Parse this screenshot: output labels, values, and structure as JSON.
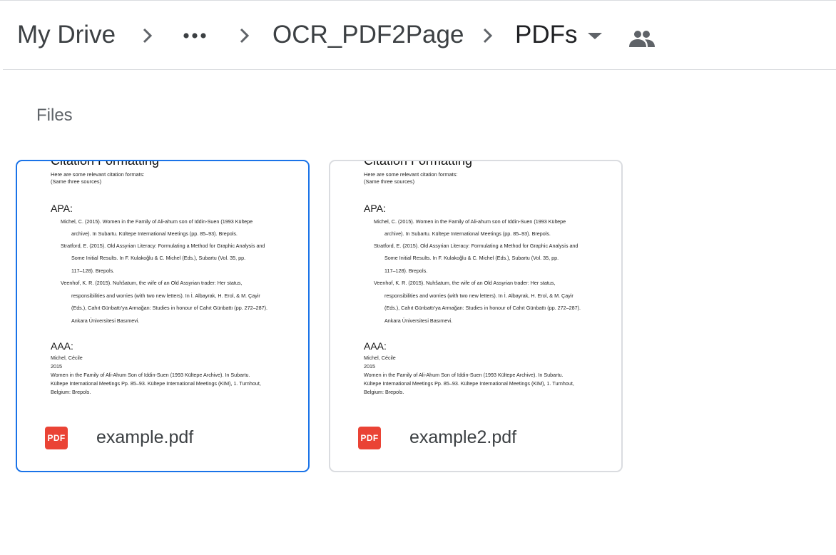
{
  "breadcrumb": {
    "root": "My Drive",
    "ellipsis": "•••",
    "parent": "OCR_PDF2Page",
    "current": "PDFs"
  },
  "section": {
    "title": "Files"
  },
  "colors": {
    "accent": "#1a73e8",
    "pdf_badge": "#ea4335",
    "border": "#dadce0"
  },
  "files": [
    {
      "name": "example.pdf",
      "badge": "PDF",
      "selected": true,
      "preview": {
        "heading": "Citation Formatting",
        "intro": "Here are some relevant citation formats:",
        "note": "(Same three sources)",
        "apa_title": "APA:",
        "apa_lines": [
          "Michel, C. (2015). Women in the Family of Ali-ahum son of Iddin-Suen (1993 Kültepe",
          "archive). In Subartu. Kültepe International Meetings (pp. 85–93). Brepols.",
          "Stratford, E. (2015). Old Assyrian Literacy: Formulating a Method for Graphic Analysis and",
          "Some Initial Results. In F. Kulakoğlu & C. Michel (Eds.), Subartu (Vol. 35, pp.",
          "117–128). Brepols.",
          "Veenhof, K. R. (2015). Nuhšatum, the wife of an Old Assyrian trader: Her status,",
          "responsibilities and worries (with two new letters). In İ. Albayrak, H. Erol, & M. Çayir",
          "(Eds.), Cahıt Günbattı'ya Armağan: Studies in honour of Cahıt Günbattı (pp. 272–287).",
          "Ankara Üniversitesi Basımevi."
        ],
        "aaa_title": "AAA:",
        "aaa_lines": [
          "Michel, Cécile",
          "2015",
          "Women in the Family of Ali-Ahum Son of Iddin-Suen (1993 Kültepe Archive). In Subartu.",
          "Kültepe International Meetings Pp. 85–93. Kültepe International Meetings (KIM), 1. Turnhout,",
          "Belgium: Brepols."
        ]
      }
    },
    {
      "name": "example2.pdf",
      "badge": "PDF",
      "selected": false,
      "preview": {
        "heading": "Citation Formatting",
        "intro": "Here are some relevant citation formats:",
        "note": "(Same three sources)",
        "apa_title": "APA:",
        "apa_lines": [
          "Michel, C. (2015). Women in the Family of Ali-ahum son of Iddin-Suen (1993 Kültepe",
          "archive). In Subartu. Kültepe International Meetings (pp. 85–93). Brepols.",
          "Stratford, E. (2015). Old Assyrian Literacy: Formulating a Method for Graphic Analysis and",
          "Some Initial Results. In F. Kulakoğlu & C. Michel (Eds.), Subartu (Vol. 35, pp.",
          "117–128). Brepols.",
          "Veenhof, K. R. (2015). Nuhšatum, the wife of an Old Assyrian trader: Her status,",
          "responsibilities and worries (with two new letters). In İ. Albayrak, H. Erol, & M. Çayir",
          "(Eds.), Cahıt Günbattı'ya Armağan: Studies in honour of Cahıt Günbattı (pp. 272–287).",
          "Ankara Üniversitesi Basımevi."
        ],
        "aaa_title": "AAA:",
        "aaa_lines": [
          "Michel, Cécile",
          "2015",
          "Women in the Family of Ali-Ahum Son of Iddin-Suen (1993 Kültepe Archive). In Subartu.",
          "Kültepe International Meetings Pp. 85–93. Kültepe International Meetings (KIM), 1. Turnhout,",
          "Belgium: Brepols."
        ]
      }
    }
  ]
}
